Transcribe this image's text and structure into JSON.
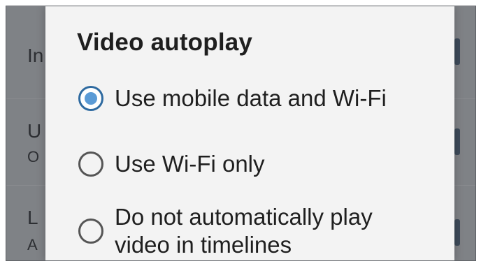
{
  "background": {
    "rows": [
      {
        "title": "In",
        "subtitle": ""
      },
      {
        "title": "U",
        "subtitle": "O"
      },
      {
        "title": "L",
        "subtitle": "A"
      }
    ]
  },
  "dialog": {
    "title": "Video autoplay",
    "options": [
      {
        "label": "Use mobile data and Wi-Fi",
        "selected": true
      },
      {
        "label": "Use Wi-Fi only",
        "selected": false
      },
      {
        "label": "Do not automatically play\nvideo in timelines",
        "selected": false
      }
    ]
  },
  "colors": {
    "radio_selected": "#5b9bd6",
    "radio_unselected": "#555555",
    "dialog_bg": "#f3f3f3",
    "scrim": "#7f8286"
  }
}
